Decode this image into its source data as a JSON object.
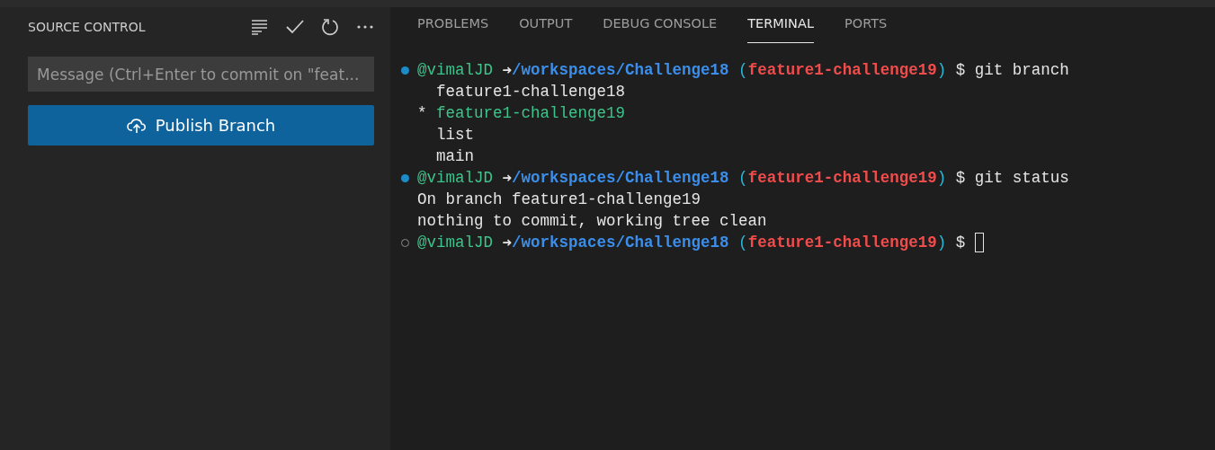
{
  "sidebar": {
    "title": "SOURCE CONTROL",
    "message": {
      "placeholder": "Message (Ctrl+Enter to commit on \"feat..."
    },
    "publish_button": "Publish Branch"
  },
  "panel": {
    "tabs": [
      {
        "label": "PROBLEMS",
        "selected": false
      },
      {
        "label": "OUTPUT",
        "selected": false
      },
      {
        "label": "DEBUG CONSOLE",
        "selected": false
      },
      {
        "label": "TERMINAL",
        "selected": true
      },
      {
        "label": "PORTS",
        "selected": false
      }
    ]
  },
  "terminal": {
    "lines": [
      {
        "kind": "prompt",
        "finished": true,
        "user": "@vimalJD",
        "arrow": "➜",
        "path": "/workspaces/Challenge18",
        "branch_open": "(",
        "branch": "feature1-challenge19",
        "branch_close": ")",
        "symbol": "$",
        "command": "git branch"
      },
      {
        "kind": "branch",
        "text": "feature1-challenge18",
        "current": false
      },
      {
        "kind": "branch",
        "marker": "*",
        "text": "feature1-challenge19",
        "current": true
      },
      {
        "kind": "branch",
        "text": "list",
        "current": false
      },
      {
        "kind": "branch",
        "text": "main",
        "current": false
      },
      {
        "kind": "prompt",
        "finished": true,
        "user": "@vimalJD",
        "arrow": "➜",
        "path": "/workspaces/Challenge18",
        "branch_open": "(",
        "branch": "feature1-challenge19",
        "branch_close": ")",
        "symbol": "$",
        "command": "git status"
      },
      {
        "kind": "output",
        "text": "On branch feature1-challenge19"
      },
      {
        "kind": "output",
        "text": "nothing to commit, working tree clean"
      },
      {
        "kind": "prompt",
        "finished": false,
        "user": "@vimalJD",
        "arrow": "➜",
        "path": "/workspaces/Challenge18",
        "branch_open": "(",
        "branch": "feature1-challenge19",
        "branch_close": ")",
        "symbol": "$",
        "cursor": true
      }
    ]
  }
}
